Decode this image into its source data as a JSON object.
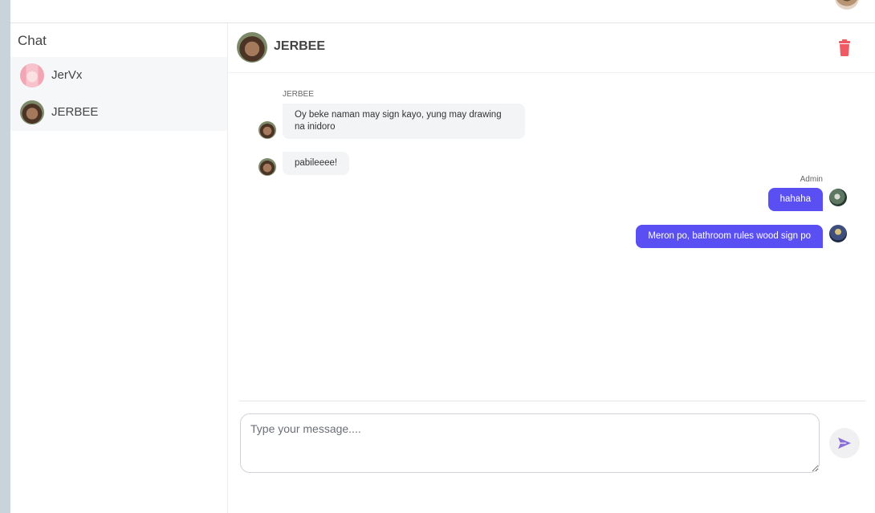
{
  "sidebar": {
    "title": "Chat",
    "contacts": [
      {
        "name": "JerVx",
        "avatar": "anime-avatar"
      },
      {
        "name": "JERBEE",
        "avatar": "user-avatar"
      }
    ]
  },
  "chat": {
    "title": "JERBEE",
    "messages": [
      {
        "direction": "incoming",
        "sender": "JERBEE",
        "text": "Oy beke naman may sign kayo, yung may drawing na inidoro"
      },
      {
        "direction": "incoming",
        "sender": "",
        "text": "pabileeee!"
      },
      {
        "direction": "outgoing",
        "sender": "Admin",
        "text": "hahaha"
      },
      {
        "direction": "outgoing",
        "sender": "",
        "text": "Meron po, bathroom rules wood sign po"
      }
    ]
  },
  "composer": {
    "placeholder": "Type your message....",
    "value": ""
  },
  "colors": {
    "accent": "#5a4ff3",
    "delete": "#f05a63",
    "send_icon": "#8b6fd6",
    "incoming_bubble": "#f3f4f6"
  },
  "icons": {
    "delete": "trash-icon",
    "send": "send-icon"
  }
}
